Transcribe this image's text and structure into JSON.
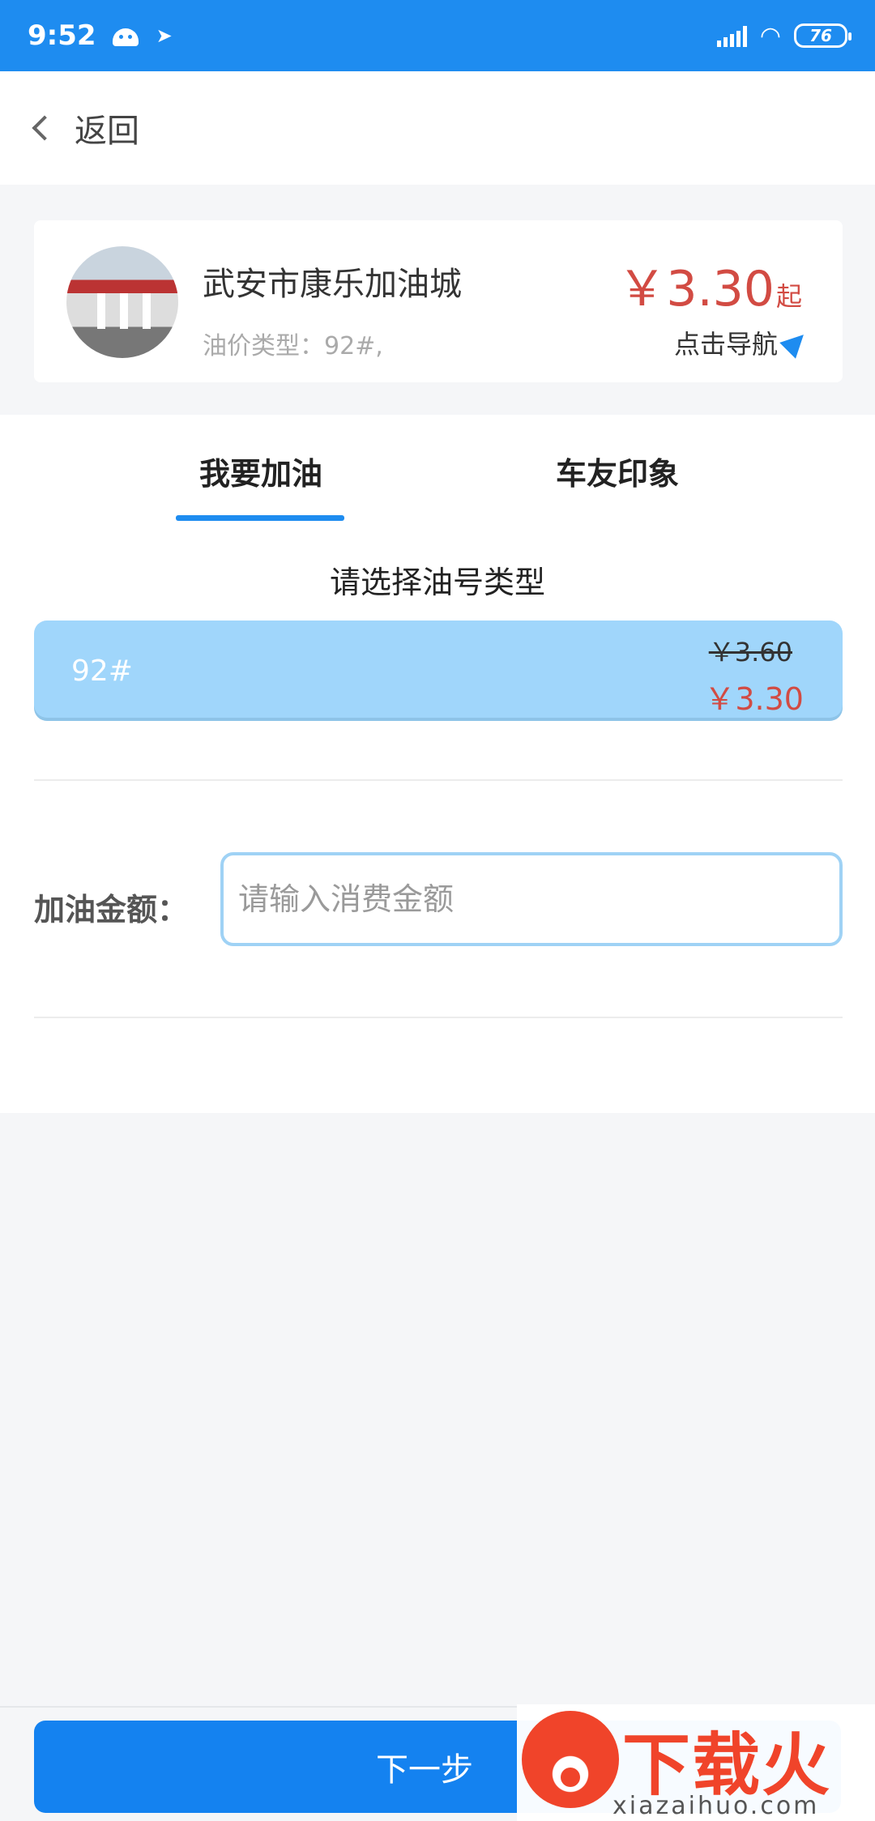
{
  "status_bar": {
    "time": "9:52",
    "battery": "76",
    "icons": [
      "android-icon",
      "bird-icon",
      "signal-icon",
      "wifi-icon",
      "battery-icon"
    ]
  },
  "header": {
    "back_label": "返回"
  },
  "station": {
    "name": "武安市康乐加油城",
    "fuel_types_text": "油价类型：92#,",
    "price_from": "￥3.30",
    "price_suffix": "起",
    "nav_label": "点击导航"
  },
  "tabs": [
    {
      "label": "我要加油",
      "active": true
    },
    {
      "label": "车友印象",
      "active": false
    }
  ],
  "fuel_section": {
    "title": "请选择油号类型",
    "options": [
      {
        "grade": "92#",
        "original_price": "￥3.60",
        "price": "￥3.30",
        "selected": true
      }
    ]
  },
  "amount": {
    "label": "加油金额：",
    "placeholder": "请输入消费金额",
    "value": ""
  },
  "footer": {
    "next_label": "下一步"
  },
  "watermark": {
    "brand": "下载火",
    "domain": "xiazaihuo.com"
  },
  "colors": {
    "primary": "#1e8cf0",
    "price_red": "#d24b43",
    "selected_option": "#a0d6fb"
  }
}
